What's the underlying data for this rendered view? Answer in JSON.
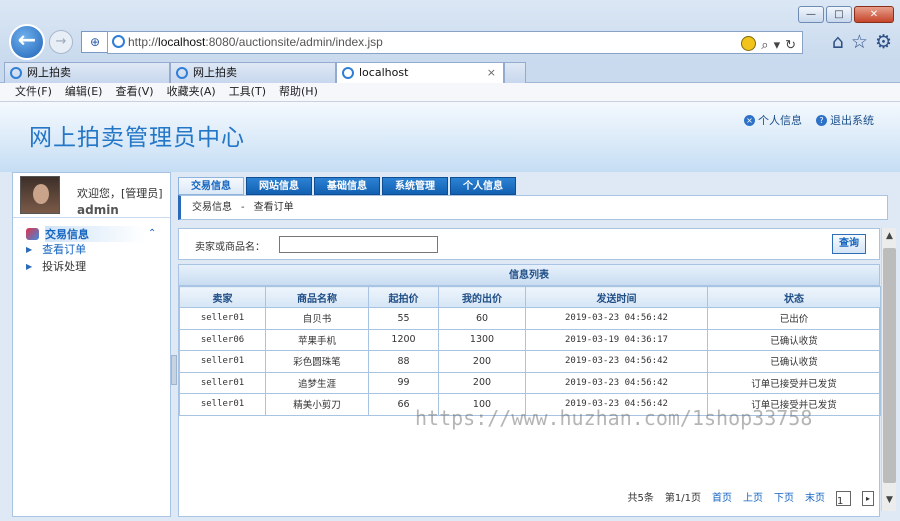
{
  "browser": {
    "address": {
      "prefix": "http://",
      "host": "localhost",
      "path": ":8080/auctionsite/admin/index.jsp"
    },
    "tabs": [
      {
        "label": "网上拍卖"
      },
      {
        "label": "网上拍卖"
      },
      {
        "label": "localhost",
        "close": "×"
      }
    ],
    "menu": [
      "文件(F)",
      "编辑(E)",
      "查看(V)",
      "收藏夹(A)",
      "工具(T)",
      "帮助(H)"
    ],
    "window_buttons": [
      "—",
      "□",
      "✕"
    ],
    "icons": {
      "back": "←",
      "forward": "→",
      "search": "⌕",
      "dropdown": "▾",
      "refresh": "↻",
      "home": "⌂",
      "star": "☆",
      "gear": "⚙",
      "shield": "⊕"
    }
  },
  "header": {
    "title": "网上拍卖管理员中心",
    "links": [
      {
        "label": "个人信息",
        "icon": "×"
      },
      {
        "label": "退出系统",
        "icon": "?"
      }
    ]
  },
  "sidebar": {
    "welcome": "欢迎您，[管理员]",
    "username": "admin",
    "group": {
      "label": "交易信息",
      "collapse": "⌃"
    },
    "items": [
      {
        "label": "查看订单"
      },
      {
        "label": "投诉处理"
      }
    ]
  },
  "main": {
    "tabs": [
      "交易信息",
      "网站信息",
      "基础信息",
      "系统管理",
      "个人信息"
    ],
    "breadcrumb": {
      "part1": "交易信息",
      "sep": "-",
      "part2": "查看订单"
    },
    "search": {
      "label": "卖家或商品名：",
      "value": "",
      "button": "查询"
    },
    "table": {
      "caption": "信息列表",
      "columns": [
        "卖家",
        "商品名称",
        "起拍价",
        "我的出价",
        "发送时间",
        "状态"
      ],
      "rows": [
        [
          "seller01",
          "自贝书",
          "55",
          "60",
          "2019-03-23 04:56:42",
          "已出价"
        ],
        [
          "seller06",
          "苹果手机",
          "1200",
          "1300",
          "2019-03-19 04:36:17",
          "已确认收货"
        ],
        [
          "seller01",
          "彩色圆珠笔",
          "88",
          "200",
          "2019-03-23 04:56:42",
          "已确认收货"
        ],
        [
          "seller01",
          "追梦生涯",
          "99",
          "200",
          "2019-03-23 04:56:42",
          "订单已接受并已发货"
        ],
        [
          "seller01",
          "精美小剪刀",
          "66",
          "100",
          "2019-03-23 04:56:42",
          "订单已接受并已发货"
        ]
      ]
    },
    "pager": {
      "total": "共5条",
      "pages": "第1/1页",
      "first": "首页",
      "prev": "上页",
      "next": "下页",
      "last": "末页",
      "page_input": "1",
      "go": "▸"
    }
  },
  "watermark": "https://www.huzhan.com/1shop33758"
}
